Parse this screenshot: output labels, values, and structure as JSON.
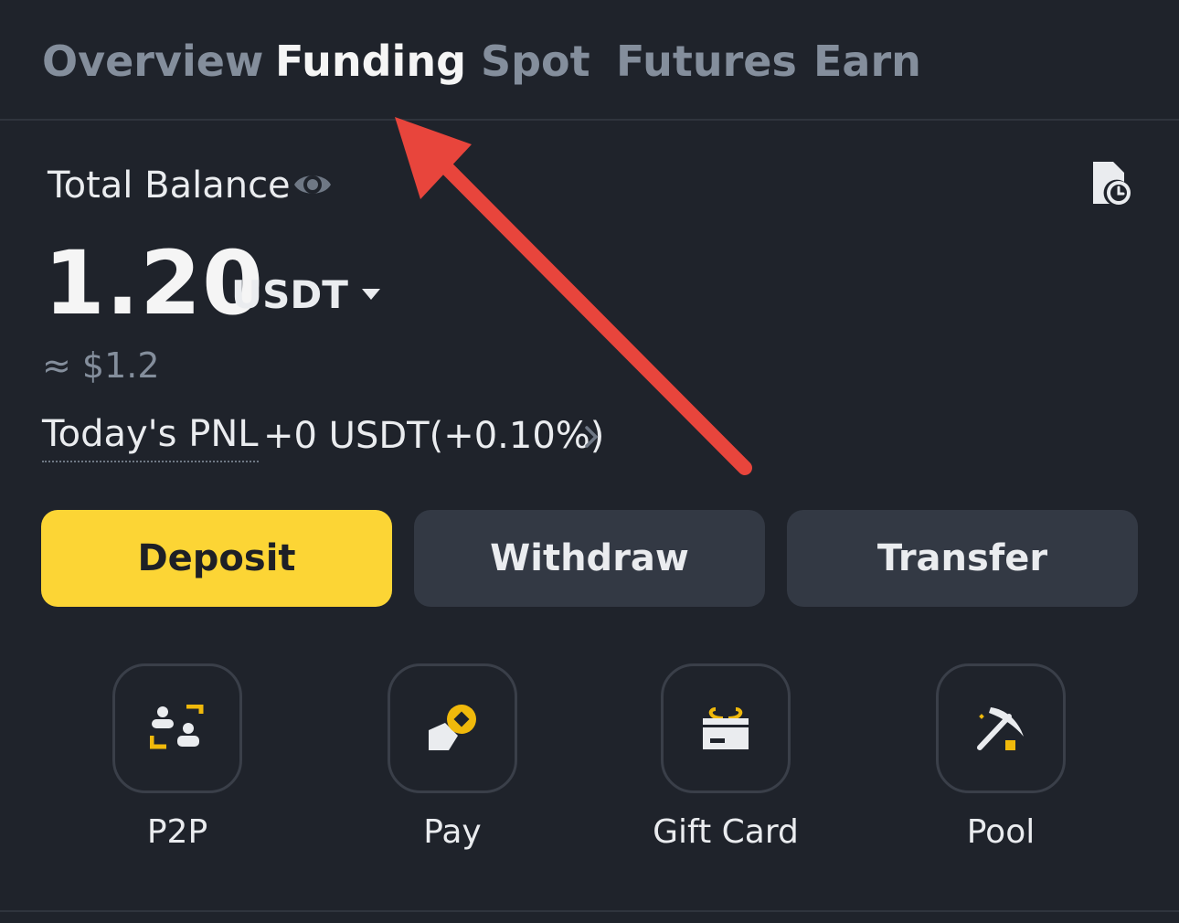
{
  "tabs": [
    {
      "label": "Overview",
      "active": false
    },
    {
      "label": "Funding",
      "active": true
    },
    {
      "label": "Spot",
      "active": false
    },
    {
      "label": "Futures",
      "active": false
    },
    {
      "label": "Earn",
      "active": false
    }
  ],
  "balance": {
    "label": "Total Balance",
    "amount": "1.20",
    "currency": "USDT",
    "fiat_approx": "≈ $1.2",
    "icons": {
      "visibility": "eye-icon",
      "history": "history-clock-icon",
      "currency_toggle": "caret-down-icon"
    }
  },
  "pnl": {
    "label": "Today's PNL",
    "value": "+0 USDT(+0.10%)"
  },
  "actions": {
    "deposit": "Deposit",
    "withdraw": "Withdraw",
    "transfer": "Transfer"
  },
  "shortcuts": [
    {
      "label": "P2P",
      "icon": "p2p-icon"
    },
    {
      "label": "Pay",
      "icon": "pay-icon"
    },
    {
      "label": "Gift Card",
      "icon": "gift-card-icon"
    },
    {
      "label": "Pool",
      "icon": "pickaxe-icon"
    }
  ],
  "colors": {
    "background": "#1f232b",
    "accent_yellow": "#fcd535",
    "button_gray": "#333944",
    "muted_text": "#848e9c",
    "annotation_arrow": "#e8453c"
  }
}
